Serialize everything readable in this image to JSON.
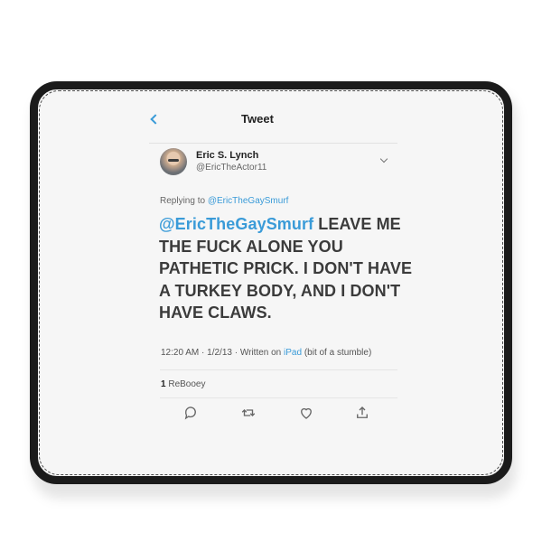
{
  "header": {
    "title": "Tweet"
  },
  "author": {
    "name": "Eric S. Lynch",
    "handle": "@EricTheActor11"
  },
  "reply": {
    "prefix": "Replying to ",
    "to": "@EricTheGaySmurf"
  },
  "tweet": {
    "mention": "@EricTheGaySmurf",
    "text": " LEAVE ME THE FUCK ALONE YOU PATHETIC PRICK. I DON'T HAVE A TURKEY BODY, AND I DON'T HAVE CLAWS."
  },
  "meta": {
    "time": "12:20 AM",
    "sep": " · ",
    "date": "1/2/13",
    "written_prefix": " · Written on ",
    "device": "iPad",
    "note": " (bit of a stumble)"
  },
  "stats": {
    "count": "1",
    "label": " ReBooey"
  },
  "actions": {
    "icons": [
      "reply-icon",
      "retweet-icon",
      "like-icon",
      "share-icon"
    ]
  },
  "colors": {
    "accent": "#3a9bd8",
    "text": "#3b3b3b",
    "pad_border": "#1b1b1b",
    "pad_surface": "#f6f6f6"
  }
}
